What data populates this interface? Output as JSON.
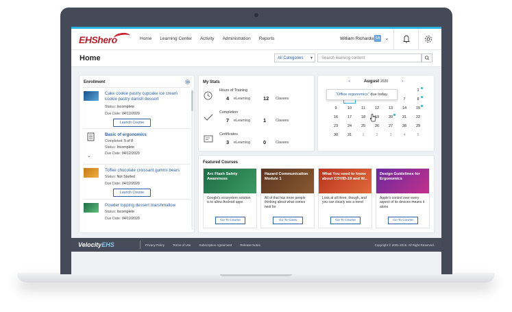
{
  "nav": {
    "logo": "EHShero",
    "links": [
      "Home",
      "Learning Center",
      "Activity",
      "Administration",
      "Reports"
    ],
    "user_name": "William Richardson",
    "user_initials": "SA"
  },
  "page": {
    "title": "Home"
  },
  "search": {
    "category": "All Categories",
    "placeholder": "Search learning content"
  },
  "enrollment": {
    "title": "Enrollment",
    "items": [
      {
        "title": "Cake cookie pastry cupcake ice cream cookie pastry danish dessert",
        "status_label": "Status:",
        "status": "Incomplete",
        "due_label": "Due Date:",
        "due": "04/12/2020",
        "button": "Launch Course"
      },
      {
        "title": "Basic of ergonomics",
        "completed_label": "Completed:",
        "completed": "5 of 8",
        "status_label": "Status:",
        "status": "Incomplete",
        "due_label": "Due Date:",
        "due": "04/12/2020"
      },
      {
        "title": "Toffee chocolate croissant gummi bears",
        "status_label": "Status:",
        "status": "Not Started",
        "due_label": "Due Date:",
        "due": "04/12/2020",
        "button": "Launch Course"
      },
      {
        "title": "Powder topping dessert marshmallow",
        "status_label": "Status:",
        "status": "Incomplete",
        "due_label": "Due Date:",
        "due": "04/12/2020"
      }
    ]
  },
  "stats": {
    "title": "My Stats",
    "rows": [
      {
        "label": "Hours of Training",
        "n1": "4",
        "u1": "eLearning",
        "n2": "12",
        "u2": "Classes"
      },
      {
        "label": "Completion",
        "n1": "7",
        "u1": "eLearning",
        "n2": "1",
        "u2": "Classes"
      },
      {
        "label": "Certificates",
        "n1": "3",
        "u1": "eLearning",
        "n2": "0",
        "u2": "Classes"
      }
    ]
  },
  "calendar": {
    "month": "August",
    "year": "2020",
    "tooltip_link": "\"Office ergonomics\"",
    "tooltip_rest": " due today.",
    "weeks": [
      [
        "",
        "",
        "",
        "",
        "",
        "",
        "1"
      ],
      [
        "2",
        "3",
        "4",
        "5",
        "6",
        "7",
        "8"
      ],
      [
        "9",
        "10",
        "11",
        "12",
        "13",
        "14",
        "15"
      ],
      [
        "16",
        "17",
        "18",
        "19",
        "20",
        "21",
        "22"
      ],
      [
        "23",
        "24",
        "25",
        "26",
        "27",
        "28",
        "29"
      ],
      [
        "30",
        "31",
        "1",
        "2",
        "3",
        "4",
        "5"
      ]
    ]
  },
  "featured": {
    "title": "Featured Courses",
    "courses": [
      {
        "title": "Arc Flash Safety Awareness",
        "desc": "Google's ecosystem solution is to allow Android apps",
        "button": "Go To Course",
        "color": "#1f6b46"
      },
      {
        "title": "Hazard Communication Module 1",
        "desc": "All of that has more people thinking about what comes next for",
        "button": "Go To Class",
        "color": "#5a3520"
      },
      {
        "title": "What You need to know about COVID-19 and W...",
        "desc": "Look at all three, though, and you can clearly see a trend",
        "button": "Go To Course",
        "color": "#b8331f"
      },
      {
        "title": "Design Guidelines for Ergonomics",
        "desc": "Apple's control over every aspect of its devices means it alone",
        "button": "Go To Course",
        "color": "#6a2aa0"
      }
    ]
  },
  "footer": {
    "logo_a": "Velocity",
    "logo_b": "EHS",
    "links": [
      "Privacy Policy",
      "Terms of Use",
      "Subscription Agreement",
      "Release Notes"
    ],
    "copyright": "Copyright © 2001-2019. All Right Reserved."
  }
}
